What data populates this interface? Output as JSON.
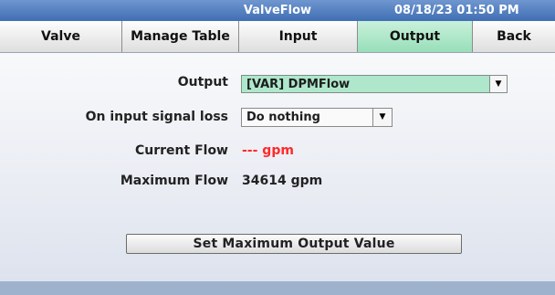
{
  "header": {
    "title": "ValveFlow",
    "datetime": "08/18/23 01:50 PM"
  },
  "tabs": [
    {
      "label": "Valve"
    },
    {
      "label": "Manage Table"
    },
    {
      "label": "Input"
    },
    {
      "label": "Output"
    },
    {
      "label": "Back"
    }
  ],
  "form": {
    "output_label": "Output",
    "output_value": "[VAR] DPMFlow",
    "loss_label": "On input signal loss",
    "loss_value": "Do nothing",
    "current_flow_label": "Current Flow",
    "current_flow_value": "--- gpm",
    "max_flow_label": "Maximum Flow",
    "max_flow_value": "34614 gpm",
    "set_button_label": "Set Maximum Output Value"
  },
  "colors": {
    "titlebar": "#4f7cc0",
    "active_tab": "#a9e6c7",
    "error_text": "#ff2a2a"
  },
  "icons": {
    "dropdown": "chevron-down-icon"
  }
}
